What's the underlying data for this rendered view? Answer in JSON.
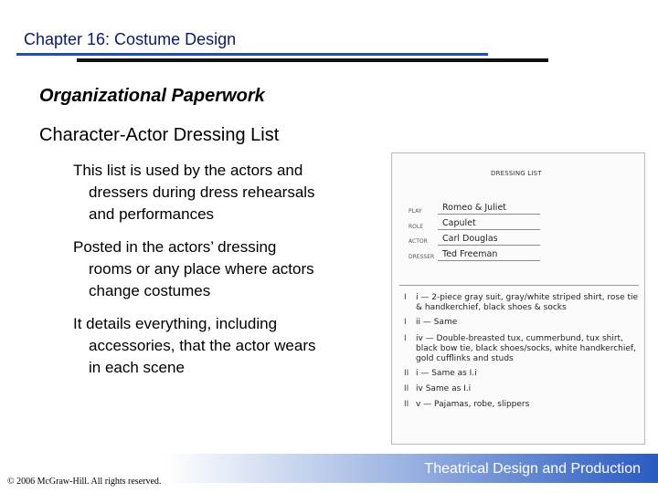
{
  "header": {
    "chapter_title": "Chapter 16: Costume Design"
  },
  "main": {
    "heading": "Organizational Paperwork",
    "subheading": "Character-Actor Dressing List",
    "bullets": [
      {
        "line1": "This list is used by the actors and",
        "line2": "dressers during dress rehearsals",
        "line3": "and performances"
      },
      {
        "line1": "Posted in the actors’ dressing",
        "line2": "rooms or any place where actors",
        "line3": "change costumes"
      },
      {
        "line1": "It details everything, including",
        "line2": "accessories, that the actor wears",
        "line3": "in each scene"
      }
    ]
  },
  "scan": {
    "title": "DRESSING LIST",
    "fields": [
      {
        "label": "PLAY",
        "value": "Romeo & Juliet"
      },
      {
        "label": "ROLE",
        "value": "Capulet"
      },
      {
        "label": "ACTOR",
        "value": "Carl Douglas"
      },
      {
        "label": "DRESSER",
        "value": "Ted Freeman"
      }
    ],
    "entries": [
      {
        "mark": "I",
        "text": "i — 2-piece gray suit, gray/white striped shirt, rose tie & handkerchief, black shoes & socks"
      },
      {
        "mark": "I",
        "text": "ii — Same"
      },
      {
        "mark": "I",
        "text": "iv — Double-breasted tux, cummerbund, tux shirt, black bow tie, black shoes/socks, white handkerchief, gold cufflinks and studs"
      },
      {
        "mark": "II",
        "text": "i — Same as I.i"
      },
      {
        "mark": "II",
        "text": "iv    Same as I.i"
      },
      {
        "mark": "II",
        "text": "v — Pajamas, robe, slippers"
      }
    ]
  },
  "footer": {
    "book_title": "Theatrical Design and Production",
    "copyright": "© 2006 McGraw-Hill. All rights reserved."
  }
}
